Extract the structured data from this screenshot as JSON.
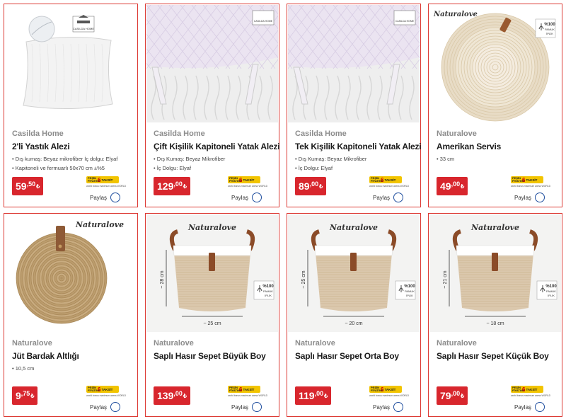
{
  "products": [
    {
      "brand": "Casilda Home",
      "title": "2'li Yastık Alezi",
      "features": [
        "• Dış kumaş: Beyaz mikrofiber İç dolgu: Elyaf",
        "• Kapitoneli ve fermuarlı 50x70 cm ±%5"
      ],
      "price_int": "59",
      "price_dec": ",50",
      "currency": "₺",
      "image": "pillow"
    },
    {
      "brand": "Casilda Home",
      "title": "Çift Kişilik Kapitoneli Yatak Alezi",
      "features": [
        "• Dış Kumaş: Beyaz Mikrofiber",
        "• İç Dolgu: Elyaf"
      ],
      "price_int": "129",
      "price_dec": ",00",
      "currency": "₺",
      "image": "mattress"
    },
    {
      "brand": "Casilda Home",
      "title": "Tek Kişilik Kapitoneli Yatak Alezi",
      "features": [
        "• Dış Kumaş: Beyaz Mikrofiber",
        "• İç Dolgu: Elyaf"
      ],
      "price_int": "89",
      "price_dec": ",00",
      "currency": "₺",
      "image": "mattress"
    },
    {
      "brand": "Naturalove",
      "title": "Amerikan Servis",
      "features": [
        "• 33 cm"
      ],
      "price_int": "49",
      "price_dec": ",00",
      "currency": "₺",
      "image": "placemat"
    },
    {
      "brand": "Naturalove",
      "title": "Jüt Bardak Altlığı",
      "features": [
        "• 10,5 cm"
      ],
      "price_int": "9",
      "price_dec": ",75",
      "currency": "₺",
      "image": "coaster"
    },
    {
      "brand": "Naturalove",
      "title": "Saplı Hasır Sepet Büyük Boy",
      "features": [],
      "price_int": "139",
      "price_dec": ",00",
      "currency": "₺",
      "image": "basket",
      "dims": {
        "height": "~ 28 cm",
        "width": "~ 25 cm"
      }
    },
    {
      "brand": "Naturalove",
      "title": "Saplı Hasır Sepet Orta Boy",
      "features": [],
      "price_int": "119",
      "price_dec": ",00",
      "currency": "₺",
      "image": "basket",
      "dims": {
        "height": "~ 25 cm",
        "width": "~ 20 cm"
      }
    },
    {
      "brand": "Naturalove",
      "title": "Saplı Hasır Sepet Küçük Boy",
      "features": [],
      "price_int": "79",
      "price_dec": ",00",
      "currency": "₺",
      "image": "basket",
      "dims": {
        "height": "~ 21 cm",
        "width": "~ 18 cm"
      }
    }
  ],
  "common": {
    "share_label": "Paylaş",
    "taksit_pesin": "PEŞİN FİYATINA",
    "taksit_num": "6",
    "taksit_word": "TAKSİT",
    "taksit_banks": "world bonus maximum axess WORLD",
    "naturalove_logo": "Naturalove",
    "casilda_logo": "CASILDA HOME",
    "cotton_badge": "%100 PAMUK İPLİK"
  },
  "colors": {
    "card_border": "#dd3b35",
    "price_bg": "#d8262d",
    "taksit_yellow": "#f2c400",
    "share_circle": "#1f4e9e",
    "brand_gray": "#8c8c8c"
  }
}
